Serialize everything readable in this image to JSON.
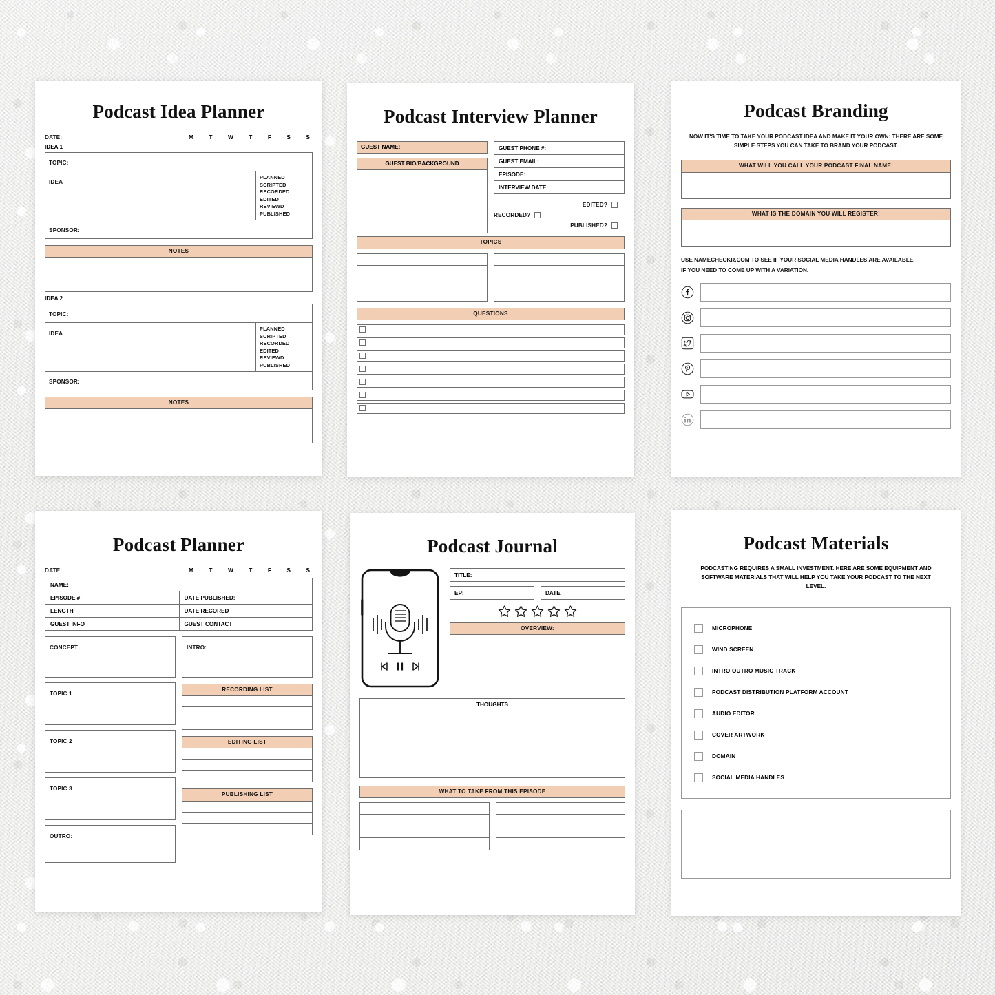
{
  "theme": {
    "accent": "#F2CFB4",
    "border": "#6F6F6F",
    "light_border": "#9A9A9A",
    "paper": "#FFFFFF",
    "backdrop": "#ECECEB"
  },
  "pages": {
    "idea_planner": {
      "title": "Podcast Idea Planner",
      "date_label": "DATE:",
      "days": [
        "M",
        "T",
        "W",
        "T",
        "F",
        "S",
        "S"
      ],
      "idea1_label": "IDEA 1",
      "idea2_label": "IDEA 2",
      "topic_label": "TOPIC:",
      "idea_label": "IDEA",
      "sponsor_label": "SPONSOR:",
      "notes_label": "NOTES",
      "status_steps": [
        "PLANNED",
        "SCRIPTED",
        "RECORDED",
        "EDITED",
        "REVIEWD",
        "PUBLISHED"
      ]
    },
    "interview_planner": {
      "title": "Podcast Interview Planner",
      "guest_name_label": "GUEST NAME:",
      "guest_bio_label": "GUEST BIO/BACKGROUND",
      "detail_rows": [
        "GUEST PHONE #:",
        "GUEST EMAIL:",
        "EPISODE:",
        "INTERVIEW DATE:"
      ],
      "flags": [
        "RECORDED?",
        "EDITED?",
        "PUBLISHED?"
      ],
      "topics_label": "TOPICS",
      "questions_label": "QUESTIONS",
      "topic_rows_per_col": 4,
      "question_rows": 7
    },
    "branding": {
      "title": "Podcast Branding",
      "intro": "NOW IT'S TIME TO TAKE YOUR PODCAST IDEA AND MAKE IT YOUR OWN: THERE ARE SOME SIMPLE STEPS YOU CAN TAKE TO BRAND YOUR PODCAST.",
      "name_header": "WHAT WILL YOU CALL YOUR PODCAST FINAL NAME:",
      "domain_header": "WHAT IS THE DOMAIN YOU WILL REGISTER!",
      "note_line1": "USE NAMECHECKR.COM TO SEE IF YOUR SOCIAL MEDIA HANDLES ARE AVAILABLE.",
      "note_line2": "IF YOU NEED TO COME UP WITH A VARIATION.",
      "socials": [
        {
          "icon": "facebook-icon",
          "name": "Facebook"
        },
        {
          "icon": "instagram-icon",
          "name": "Instagram"
        },
        {
          "icon": "twitter-icon",
          "name": "Twitter"
        },
        {
          "icon": "pinterest-icon",
          "name": "Pinterest"
        },
        {
          "icon": "youtube-icon",
          "name": "YouTube"
        },
        {
          "icon": "linkedin-icon",
          "name": "LinkedIn"
        }
      ]
    },
    "planner": {
      "title": "Podcast Planner",
      "date_label": "DATE:",
      "days": [
        "M",
        "T",
        "W",
        "T",
        "F",
        "S",
        "S"
      ],
      "name_label": "NAME:",
      "info_rows": [
        [
          "EPISODE #",
          "DATE PUBLISHED:"
        ],
        [
          "LENGTH",
          "DATE RECORED"
        ],
        [
          "GUEST INFO",
          "GUEST CONTACT"
        ]
      ],
      "concept_label": "CONCEPT",
      "intro_label": "INTRO:",
      "topic1_label": "TOPIC 1",
      "topic2_label": "TOPIC 2",
      "topic3_label": "TOPIC 3",
      "outro_label": "OUTRO:",
      "recording_list_label": "RECORDING LIST",
      "editing_list_label": "EDITING LIST",
      "publishing_list_label": "PUBLISHING LIST",
      "list_rows": 3
    },
    "journal": {
      "title": "Podcast Journal",
      "title_label": "TITLE:",
      "ep_label": "EP:",
      "date_label": "DATE",
      "stars": 5,
      "overview_label": "OVERVIEW:",
      "thoughts_label": "THOUGHTS",
      "thought_lines": 6,
      "takeaway_label": "WHAT TO TAKE FROM THIS EPISODE",
      "takeaway_rows_per_col": 4,
      "phone_controls": [
        "prev-track-icon",
        "pause-icon",
        "next-track-icon"
      ]
    },
    "materials": {
      "title": "Podcast Materials",
      "intro": "PODCASTING REQUIRES A SMALL INVESTMENT. HERE ARE SOME EQUIPMENT AND SOFTWARE MATERIALS THAT WILL HELP YOU TAKE YOUR PODCAST TO THE NEXT LEVEL.",
      "checklist": [
        "MICROPHONE",
        "WIND SCREEN",
        "INTRO OUTRO MUSIC TRACK",
        "PODCAST DISTRIBUTION PLATFORM ACCOUNT",
        "AUDIO EDITOR",
        "COVER ARTWORK",
        "DOMAIN",
        "SOCIAL MEDIA HANDLES"
      ]
    }
  }
}
